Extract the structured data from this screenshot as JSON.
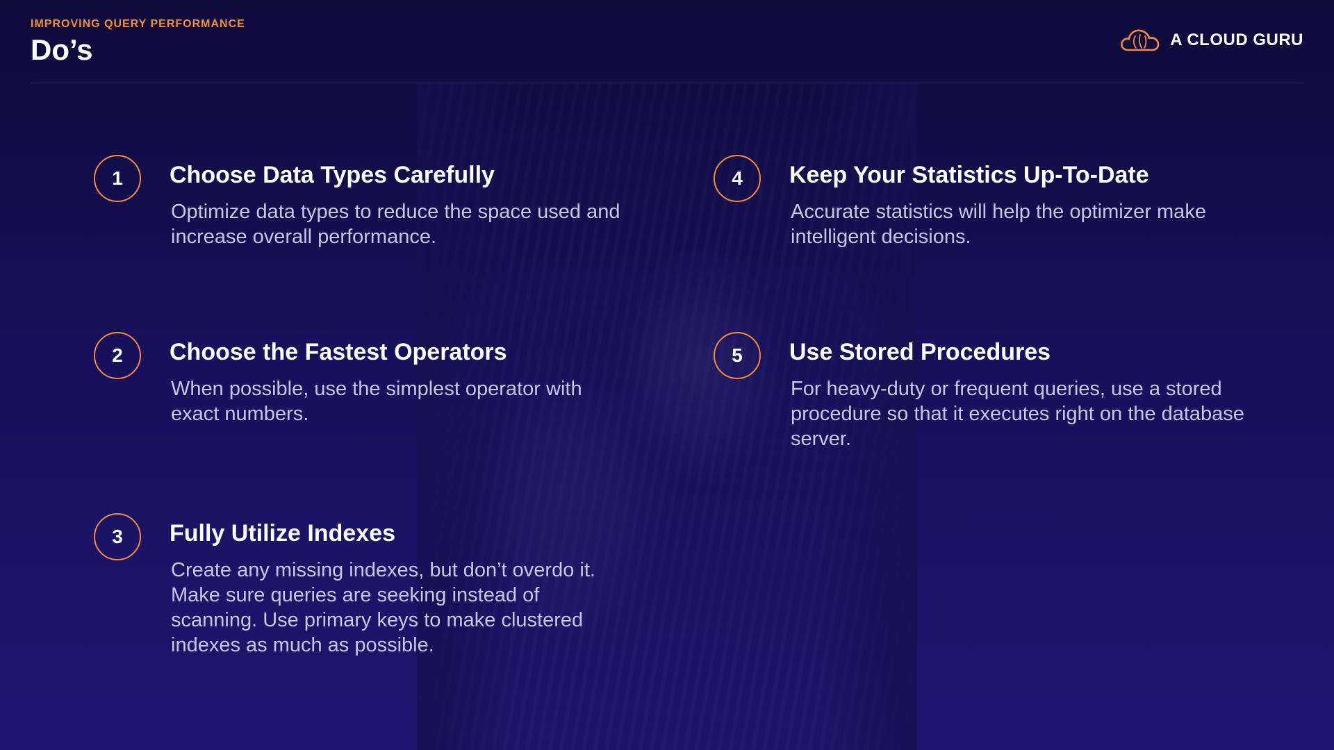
{
  "header": {
    "eyebrow": "IMPROVING QUERY PERFORMANCE",
    "title": "Do’s"
  },
  "brand": {
    "name": "A CLOUD GURU",
    "logo_icon": "cloud-icon"
  },
  "colors": {
    "accent": "#f58b3c",
    "background": "#17105a",
    "body_text": "#c9c6e4"
  },
  "items": [
    {
      "number": "1",
      "title": "Choose Data Types Carefully",
      "description": "Optimize data types to reduce the space used and increase overall performance."
    },
    {
      "number": "2",
      "title": "Choose the Fastest Operators",
      "description": "When possible, use the simplest operator with exact numbers."
    },
    {
      "number": "3",
      "title": "Fully Utilize Indexes",
      "description": "Create any missing indexes, but don’t overdo it. Make sure queries are seeking instead of scanning. Use primary keys to make clustered indexes as much as possible."
    },
    {
      "number": "4",
      "title": "Keep Your Statistics Up-To-Date",
      "description": "Accurate statistics will help the optimizer make intelligent decisions."
    },
    {
      "number": "5",
      "title": "Use Stored Procedures",
      "description": "For heavy-duty or frequent queries, use a stored procedure so that it executes right on the database server."
    }
  ]
}
